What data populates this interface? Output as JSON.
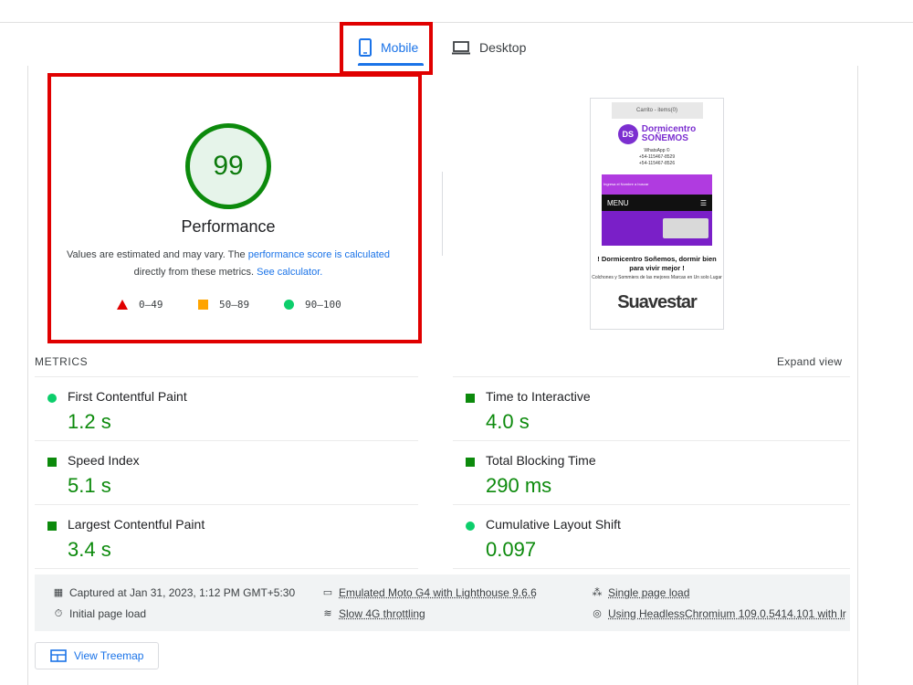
{
  "tabs": [
    {
      "label": "Mobile",
      "icon": "phone-icon",
      "active": true
    },
    {
      "label": "Desktop",
      "icon": "laptop-icon",
      "active": false
    }
  ],
  "score": {
    "value": "99",
    "title": "Performance",
    "note_prefix": "Values are estimated and may vary. The ",
    "note_link1": "performance score is calculated",
    "note_mid": "directly from these metrics. ",
    "note_link2": "See calculator."
  },
  "legend": [
    {
      "range": "0–49",
      "shape": "triangle",
      "color": "#e00000"
    },
    {
      "range": "50–89",
      "shape": "square",
      "color": "#ffa400"
    },
    {
      "range": "90–100",
      "shape": "circle",
      "color": "#0cce6b"
    }
  ],
  "thumbnail": {
    "cart": "Carrito - items(0)",
    "logo_mark": "DS",
    "logo_line1": "Dormicentro",
    "logo_line2": "SOÑEMOS",
    "whatsapp": "WhatsApp ©",
    "phone1": "+54-115467-8529",
    "phone2": "+54-115467-8526",
    "purple_bar": "Ingresa el Nombre a buscar",
    "menu": "MENU",
    "menu_icon": "☰",
    "headline": "! Dormicentro Soñemos, dormir bien para vivir mejor !",
    "sub": "Colchones y Sommiers de las mejores Marcas en Un solo Lugar",
    "brand": "Suavestar"
  },
  "metrics": {
    "header": "METRICS",
    "expand": "Expand view",
    "items": [
      {
        "label": "First Contentful Paint",
        "value": "1.2 s",
        "icon": "circle"
      },
      {
        "label": "Time to Interactive",
        "value": "4.0 s",
        "icon": "square"
      },
      {
        "label": "Speed Index",
        "value": "5.1 s",
        "icon": "square"
      },
      {
        "label": "Total Blocking Time",
        "value": "290 ms",
        "icon": "square"
      },
      {
        "label": "Largest Contentful Paint",
        "value": "3.4 s",
        "icon": "square"
      },
      {
        "label": "Cumulative Layout Shift",
        "value": "0.097",
        "icon": "circle"
      }
    ]
  },
  "info": {
    "captured": "Captured at Jan 31, 2023, 1:12 PM GMT+5:30",
    "emulated": "Emulated Moto G4 with Lighthouse 9.6.6",
    "single_page": "Single page load",
    "initial_load": "Initial page load",
    "throttling": "Slow 4G throttling",
    "browser": "Using HeadlessChromium 109.0.5414.101 with lr"
  },
  "treemap": {
    "label": "View Treemap"
  },
  "colors": {
    "accent": "#1a73e8",
    "good": "#0c8a0c",
    "highlight": "#e00000"
  }
}
